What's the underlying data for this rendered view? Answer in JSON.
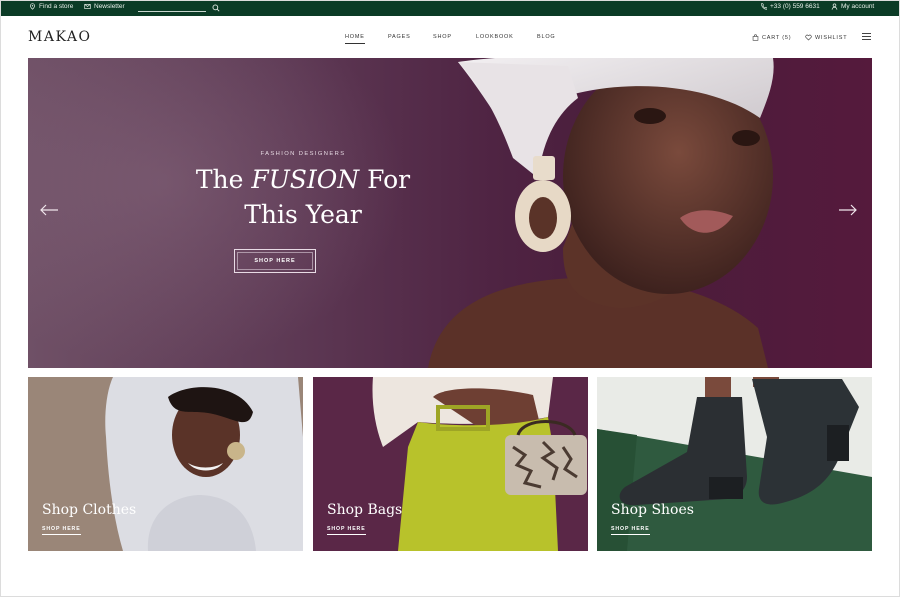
{
  "topbar": {
    "find_store": "Find a store",
    "newsletter": "Newsletter",
    "phone": "+33 (0) 559 6631",
    "account": "My account"
  },
  "header": {
    "logo": "MAKAO",
    "nav": [
      "HOME",
      "PAGES",
      "SHOP",
      "LOOKBOOK",
      "BLOG"
    ],
    "active_nav": "HOME",
    "cart": "CART (5)",
    "wishlist": "WISHLIST"
  },
  "hero": {
    "eyebrow": "FASHION DESIGNERS",
    "title_line1_pre": "The ",
    "title_line1_em": "FUSION",
    "title_line1_post": " For",
    "title_line2": "This Year",
    "button": "SHOP HERE"
  },
  "tiles": [
    {
      "title": "Shop Clothes",
      "link": "SHOP HERE"
    },
    {
      "title": "Shop Bags",
      "link": "SHOP HERE"
    },
    {
      "title": "Shop Shoes",
      "link": "SHOP HERE"
    }
  ],
  "colors": {
    "topbar_bg": "#0b3b26",
    "hero_bg": "#4f2443",
    "tile_clothes_bg": "#9a8678",
    "tile_bags_bg": "#5a2747",
    "tile_shoes_bg": "#2f5a3f"
  },
  "icons": [
    "location-pin-icon",
    "mail-icon",
    "search-icon",
    "phone-icon",
    "user-icon",
    "bag-icon",
    "heart-icon",
    "menu-icon",
    "arrow-left-icon",
    "arrow-right-icon"
  ]
}
